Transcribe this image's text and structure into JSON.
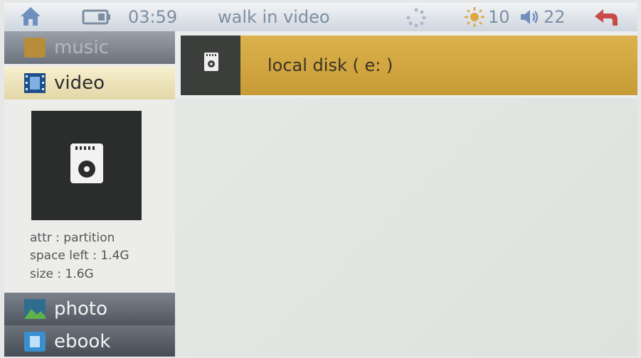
{
  "status_bar": {
    "home_icon": "home-icon",
    "battery_icon": "battery-icon",
    "time": "03:59",
    "title": "walk in video",
    "loading_icon": "loading-icon",
    "brightness_icon": "brightness-icon",
    "brightness_value": "10",
    "volume_icon": "volume-icon",
    "volume_value": "22",
    "back_icon": "back-arrow-icon"
  },
  "sidebar": {
    "items": [
      {
        "label": "music",
        "icon": "music-icon"
      },
      {
        "label": "video",
        "icon": "film-icon",
        "selected": true
      },
      {
        "label": "photo",
        "icon": "photo-icon"
      },
      {
        "label": "ebook",
        "icon": "ebook-icon"
      }
    ],
    "info": {
      "icon": "sd-card-icon",
      "attr": "attr : partition",
      "space_left": "space left : 1.4G",
      "size": "size : 1.6G"
    }
  },
  "main": {
    "path_icon": "sd-card-icon",
    "path_label": "local disk ( e: )"
  },
  "colors": {
    "status_text": "#7c8ea4",
    "selected_tab": "#f1e8c4",
    "path_bar": "#d2a843",
    "back_arrow": "#c94a4a"
  }
}
